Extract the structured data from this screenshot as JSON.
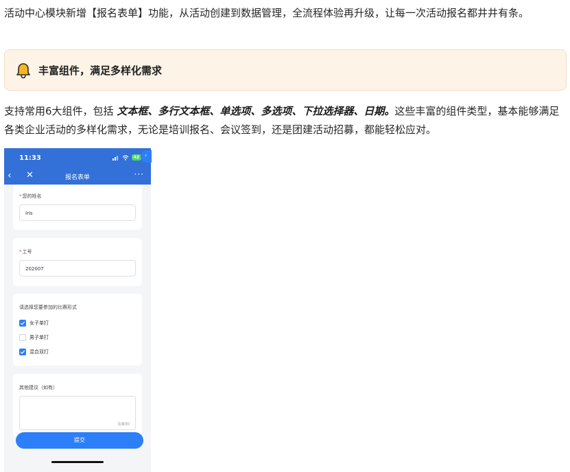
{
  "intro": "活动中心模块新增【报名表单】功能，从活动创建到数据管理，全流程体验再升级，让每一次活动报名都井井有条。",
  "callout": {
    "title": "丰富组件，满足多样化需求",
    "icon": "bell-icon"
  },
  "desc": {
    "prefix": "支持常用6大组件，包括 ",
    "components": "文本框、多行文本框、单选项、多选项、下拉选择器、日期。",
    "suffix": "这些丰富的组件类型，基本能够满足各类企业活动的多样化需求，无论是培训报名、会议签到，还是团建活动招募，都能轻松应对。"
  },
  "phone": {
    "status": {
      "time": "11:33",
      "battery": "42"
    },
    "nav": {
      "title": "报名表单",
      "back": "‹",
      "close": "✕",
      "more": "···"
    },
    "name_field": {
      "label": "您的姓名",
      "value": "Iris"
    },
    "id_field": {
      "label": "工号",
      "value": "202007"
    },
    "match_field": {
      "label": "请选择您要参加的比赛形式",
      "options": [
        {
          "label": "女子单打",
          "checked": true
        },
        {
          "label": "男子单打",
          "checked": false
        },
        {
          "label": "混合双打",
          "checked": true
        }
      ]
    },
    "suggest_field": {
      "label": "其他建议（如有）",
      "counter": "0/800"
    },
    "submit": "提交",
    "side_arrow": "‹"
  },
  "colors": {
    "brand": "#3370d8",
    "accent": "#2d7ff9",
    "callout_bg": "#fdf3e7"
  }
}
